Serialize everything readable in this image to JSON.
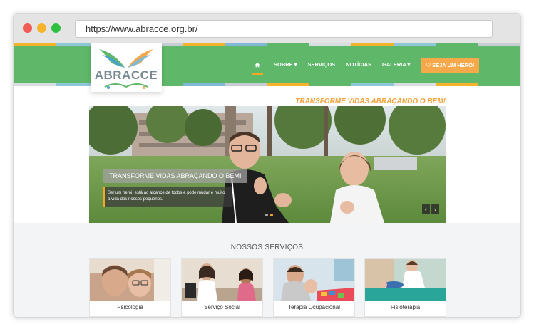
{
  "browser": {
    "url": "https://www.abracce.org.br/"
  },
  "site": {
    "logo_text": "ABRACCE",
    "nav": {
      "home_icon": "home-icon",
      "items": [
        "SOBRE ▾",
        "SERVIÇOS",
        "NOTÍCIAS",
        "GALERIA ▾"
      ],
      "cta": "♡ SEJA UM HERÓI"
    },
    "tagline": "TRANSFORME VIDAS ABRAÇANDO O BEM!",
    "slider": {
      "caption_title": "TRANSFORME VIDAS ABRAÇANDO O BEM!",
      "caption_text": "Ser um herói, está ao alcance de todos e pode mudar e muito a vida dos nossos pequenos.",
      "prev_icon": "chevron-left-icon",
      "next_icon": "chevron-right-icon",
      "prev_glyph": "‹",
      "next_glyph": "›"
    },
    "services": {
      "title": "NOSSOS SERVIÇOS",
      "items": [
        "Psicologia",
        "Serviço Social",
        "Terapia Ocupacional",
        "Fisioterapia"
      ]
    }
  },
  "colors": {
    "header_green": "#5fb86a",
    "accent_orange": "#f5a94a",
    "tagline_orange": "#f2a33c"
  }
}
